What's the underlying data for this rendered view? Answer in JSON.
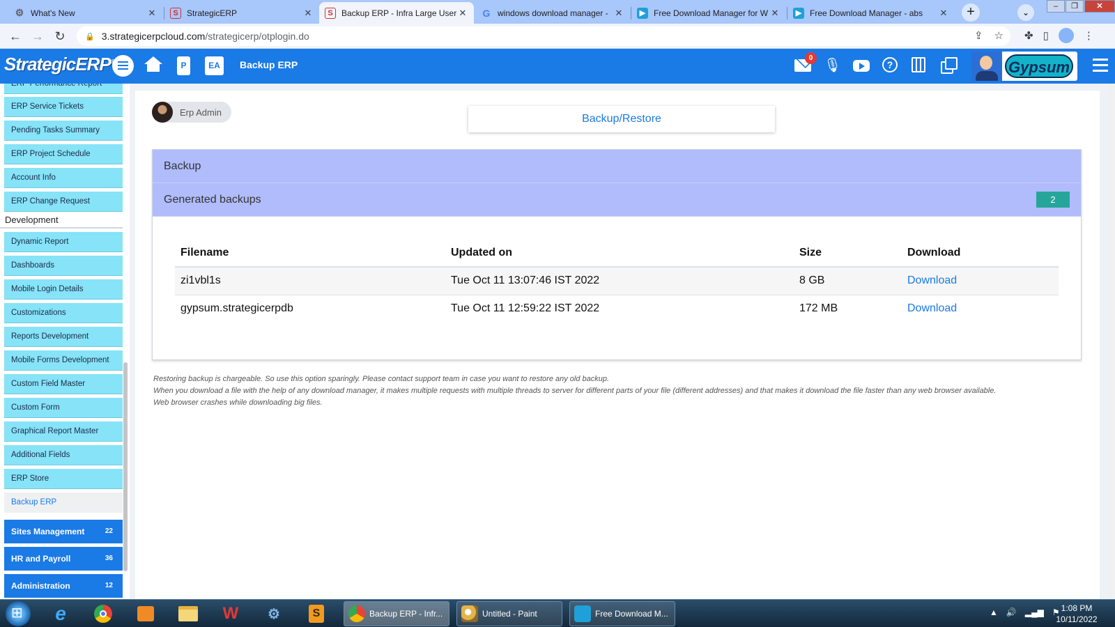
{
  "browser": {
    "tabs": [
      {
        "title": "What's New"
      },
      {
        "title": "StrategicERP"
      },
      {
        "title": "Backup ERP - Infra Large User:"
      },
      {
        "title": "windows download manager -"
      },
      {
        "title": "Free Download Manager for W"
      },
      {
        "title": "Free Download Manager - abs"
      }
    ],
    "url_host": "3.strategicerpcloud.com",
    "url_path": "/strategicerp/otplogin.do"
  },
  "header": {
    "logo": "StrategicERP",
    "logo_mark": "®",
    "btn_p": "P",
    "btn_ea": "EA",
    "title": "Backup ERP",
    "mail_count": "0",
    "brand": "Gypsum"
  },
  "sidebar": {
    "items_top": [
      "ERP Performance Report",
      "ERP Service Tickets",
      "Pending Tasks Summary",
      "ERP Project Schedule",
      "Account Info",
      "ERP Change Request"
    ],
    "section": "Development",
    "items_dev": [
      "Dynamic Report",
      "Dashboards",
      "Mobile Login Details",
      "Customizations",
      "Reports Development",
      "Mobile Forms Development",
      "Custom Field Master",
      "Custom Form",
      "Graphical Report Master",
      "Additional Fields",
      "ERP Store",
      "Backup ERP"
    ],
    "groups": [
      {
        "label": "Sites Management",
        "count": "22"
      },
      {
        "label": "HR and Payroll",
        "count": "36"
      },
      {
        "label": "Administration",
        "count": "12"
      }
    ]
  },
  "main": {
    "user": "Erp Admin",
    "tab_label": "Backup/Restore",
    "panel_title": "Backup",
    "generated_title": "Generated backups",
    "generated_count": "2",
    "columns": [
      "Filename",
      "Updated on",
      "Size",
      "Download"
    ],
    "rows": [
      {
        "filename": "zi1vbl1s",
        "updated": "Tue Oct 11 13:07:46 IST 2022",
        "size": "8 GB",
        "download": "Download"
      },
      {
        "filename": "gypsum.strategicerpdb",
        "updated": "Tue Oct 11 12:59:22 IST 2022",
        "size": "172 MB",
        "download": "Download"
      }
    ],
    "notes": [
      "Restoring backup is chargeable. So use this option sparingly. Please contact support team in case you want to restore any old backup.",
      "When you download a file with the help of any download manager, it makes multiple requests with multiple threads to server for different parts of your file (different addresses) and that makes it download the file faster than any web browser available.",
      "Web browser crashes while downloading big files."
    ]
  },
  "taskbar": {
    "windows": [
      {
        "title": "Backup ERP - Infr..."
      },
      {
        "title": "Untitled - Paint"
      },
      {
        "title": "Free Download M..."
      }
    ],
    "time": "1:08 PM",
    "date": "10/11/2022"
  },
  "colors": {
    "app_blue": "#1a7ae6",
    "sidebar_item": "#87e3f7",
    "panel_header": "#b0bcfb",
    "count_badge": "#26a69a"
  }
}
